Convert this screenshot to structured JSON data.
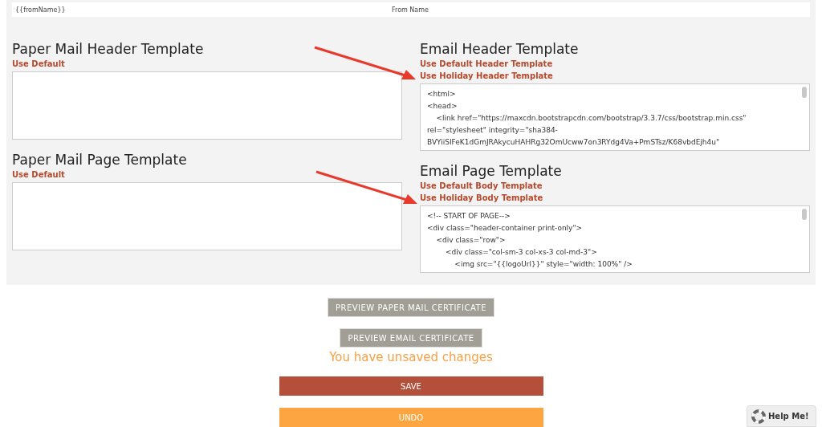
{
  "from_row": {
    "variable": "{{fromName}}",
    "label": "From Name"
  },
  "left_sections": [
    {
      "title": "Paper Mail Header Template",
      "links": [
        "Use Default"
      ]
    },
    {
      "title": "Paper Mail Page Template",
      "links": [
        "Use Default"
      ]
    }
  ],
  "right_sections": [
    {
      "title": "Email Header Template",
      "links": [
        "Use Default Header Template",
        "Use Holiday Header Template"
      ],
      "editor_lines": [
        "<html>",
        "<head>",
        "    <link href=\"https://maxcdn.bootstrapcdn.com/bootstrap/3.3.7/css/bootstrap.min.css\" rel=\"stylesheet\" integrity=\"sha384-BVYiiSIFeK1dGmJRAkycuHAHRg32OmUcww7on3RYdg4Va+PmSTsz/K68vbdEjh4u\""
      ]
    },
    {
      "title": "Email Page Template",
      "links": [
        "Use Default Body Template",
        "Use Holiday Body Template"
      ],
      "editor_lines": [
        "<!-- START OF PAGE-->",
        "<div class=\"header-container print-only\">",
        "    <div class=\"row\">",
        "        <div class=\"col-sm-3 col-xs-3 col-md-3\">",
        "            <img src=\"{{logoUrl}}\" style=\"width: 100%\" />"
      ]
    }
  ],
  "buttons": [
    {
      "kind": "preview",
      "label": "PREVIEW PAPER MAIL CERTIFICATE"
    },
    {
      "kind": "preview",
      "label": "PREVIEW EMAIL CERTIFICATE"
    }
  ],
  "status_message": "You have unsaved changes",
  "actions": [
    {
      "kind": "save",
      "label": "SAVE"
    },
    {
      "kind": "undo",
      "label": "UNDO"
    }
  ],
  "help_badge": {
    "label": "Help Me!"
  }
}
